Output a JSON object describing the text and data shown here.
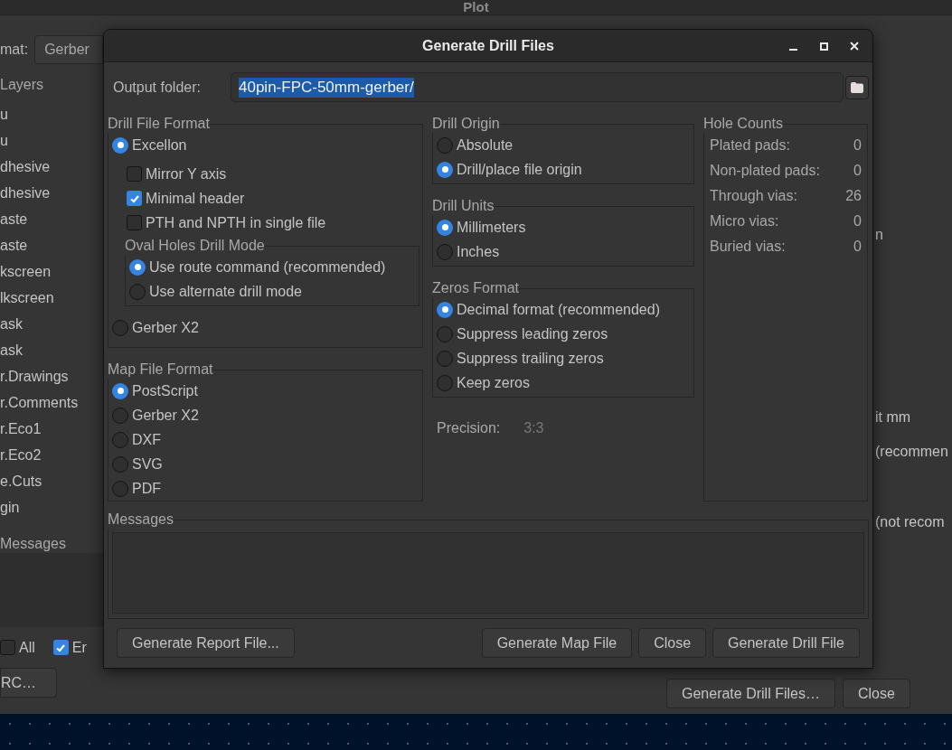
{
  "background": {
    "title": "Plot",
    "format_label": "mat:",
    "format_value": "Gerber",
    "layers_title": "Layers",
    "layers": [
      "u",
      "u",
      "dhesive",
      "dhesive",
      "aste",
      "aste",
      "kscreen",
      "lkscreen",
      "ask",
      "ask",
      "r.Drawings",
      "r.Comments",
      "r.Eco1",
      "r.Eco2",
      "e.Cuts",
      "gin"
    ],
    "messages_title": "Messages",
    "checkboxes": [
      {
        "label": "All",
        "checked": false
      },
      {
        "label": "Er",
        "checked": true
      }
    ],
    "left_button": "RC…",
    "right_texts": [
      "n",
      "it mm",
      "(recommen",
      "(not recom"
    ],
    "buttons": [
      "Generate Drill Files…",
      "Close"
    ]
  },
  "dialog": {
    "title": "Generate Drill Files",
    "output_label": "Output folder:",
    "output_value": "40pin-FPC-50mm-gerber/",
    "drill_file_format": {
      "title": "Drill File Format",
      "formats": [
        {
          "label": "Excellon",
          "selected": true
        },
        {
          "label": "Gerber X2",
          "selected": false
        }
      ],
      "options": [
        {
          "label": "Mirror Y axis",
          "checked": false
        },
        {
          "label": "Minimal header",
          "checked": true
        },
        {
          "label": "PTH and NPTH in single file",
          "checked": false
        }
      ],
      "oval_holes": {
        "title": "Oval Holes Drill Mode",
        "modes": [
          {
            "label": "Use route command (recommended)",
            "selected": true
          },
          {
            "label": "Use alternate drill mode",
            "selected": false
          }
        ]
      }
    },
    "map_file_format": {
      "title": "Map File Format",
      "options": [
        {
          "label": "PostScript",
          "selected": true
        },
        {
          "label": "Gerber X2",
          "selected": false
        },
        {
          "label": "DXF",
          "selected": false
        },
        {
          "label": "SVG",
          "selected": false
        },
        {
          "label": "PDF",
          "selected": false
        }
      ]
    },
    "drill_origin": {
      "title": "Drill Origin",
      "options": [
        {
          "label": "Absolute",
          "selected": false
        },
        {
          "label": "Drill/place file origin",
          "selected": true
        }
      ]
    },
    "drill_units": {
      "title": "Drill Units",
      "options": [
        {
          "label": "Millimeters",
          "selected": true
        },
        {
          "label": "Inches",
          "selected": false
        }
      ]
    },
    "zeros_format": {
      "title": "Zeros Format",
      "options": [
        {
          "label": "Decimal format (recommended)",
          "selected": true
        },
        {
          "label": "Suppress leading zeros",
          "selected": false
        },
        {
          "label": "Suppress trailing zeros",
          "selected": false
        },
        {
          "label": "Keep zeros",
          "selected": false
        }
      ]
    },
    "precision": {
      "label": "Precision:",
      "value": "3:3"
    },
    "hole_counts": {
      "title": "Hole Counts",
      "rows": [
        {
          "label": "Plated pads:",
          "value": "0"
        },
        {
          "label": "Non-plated pads:",
          "value": "0"
        },
        {
          "label": "Through vias:",
          "value": "26"
        },
        {
          "label": "Micro vias:",
          "value": "0"
        },
        {
          "label": "Buried vias:",
          "value": "0"
        }
      ]
    },
    "messages_title": "Messages",
    "buttons": {
      "report": "Generate Report File...",
      "map": "Generate Map File",
      "close": "Close",
      "drill": "Generate Drill File"
    }
  }
}
